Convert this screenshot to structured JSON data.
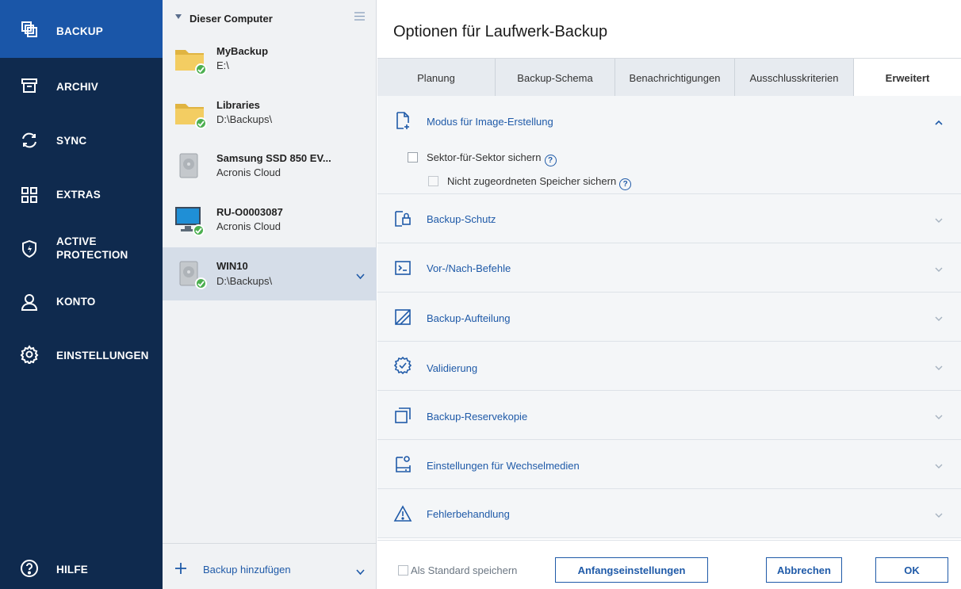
{
  "nav": {
    "items": [
      {
        "label": "BACKUP",
        "icon": "backup-icon"
      },
      {
        "label": "ARCHIV",
        "icon": "archive-icon"
      },
      {
        "label": "SYNC",
        "icon": "sync-icon"
      },
      {
        "label": "EXTRAS",
        "icon": "grid-icon"
      },
      {
        "label": "ACTIVE\nPROTECTION",
        "icon": "shield-icon"
      },
      {
        "label": "KONTO",
        "icon": "user-icon"
      },
      {
        "label": "EINSTELLUNGEN",
        "icon": "gear-icon"
      }
    ],
    "help_label": "HILFE",
    "active_color": "#1a56a8",
    "bg_color": "#0f2a4e"
  },
  "list": {
    "header": "Dieser Computer",
    "entries": [
      {
        "name": "MyBackup",
        "location": "E:\\",
        "icon": "folder-icon"
      },
      {
        "name": "Libraries",
        "location": "D:\\Backups\\",
        "icon": "folder-icon"
      },
      {
        "name": "Samsung SSD 850 EV...",
        "location": "Acronis Cloud",
        "icon": "disk-icon"
      },
      {
        "name": "RU-O0003087",
        "location": "Acronis Cloud",
        "icon": "monitor-icon"
      },
      {
        "name": "WIN10",
        "location": "D:\\Backups\\",
        "icon": "disk-icon"
      }
    ],
    "add_label": "Backup hinzufügen"
  },
  "main": {
    "title": "Optionen für Laufwerk-Backup",
    "tabs": [
      "Planung",
      "Backup-Schema",
      "Benachrichtigungen",
      "Ausschlusskriterien",
      "Erweitert"
    ],
    "active_tab": "Erweitert",
    "sections": [
      {
        "label": "Modus für Image-Erstellung",
        "icon": "image-mode-icon",
        "expanded": true
      },
      {
        "label": "Backup-Schutz",
        "icon": "lock-icon"
      },
      {
        "label": "Vor-/Nach-Befehle",
        "icon": "terminal-icon"
      },
      {
        "label": "Backup-Aufteilung",
        "icon": "split-icon"
      },
      {
        "label": "Validierung",
        "icon": "badge-icon"
      },
      {
        "label": "Backup-Reservekopie",
        "icon": "copy-icon"
      },
      {
        "label": "Einstellungen für Wechselmedien",
        "icon": "removable-media-icon"
      },
      {
        "label": "Fehlerbehandlung",
        "icon": "warning-icon"
      }
    ],
    "options": {
      "sector_by_sector": "Sektor-für-Sektor sichern",
      "unallocated": "Nicht zugeordneten Speicher sichern",
      "help_glyph": "?"
    },
    "footer": {
      "save_default": "Als Standard speichern",
      "reset": "Anfangseinstellungen",
      "cancel": "Abbrechen",
      "ok": "OK"
    },
    "accent_color": "#1f5aa8"
  }
}
